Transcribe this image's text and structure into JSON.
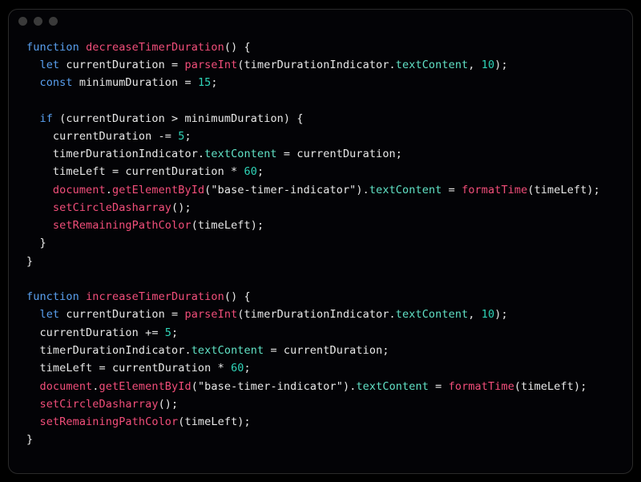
{
  "titlebar": {
    "dots": 3
  },
  "code": {
    "tokens": [
      {
        "c": "kw",
        "t": "function"
      },
      {
        "c": "pun",
        "t": " "
      },
      {
        "c": "fn",
        "t": "decreaseTimerDuration"
      },
      {
        "c": "pun",
        "t": "() {"
      },
      {
        "c": "nl",
        "t": "\n"
      },
      {
        "c": "pun",
        "t": "  "
      },
      {
        "c": "kw",
        "t": "let"
      },
      {
        "c": "pun",
        "t": " currentDuration = "
      },
      {
        "c": "fn",
        "t": "parseInt"
      },
      {
        "c": "pun",
        "t": "(timerDurationIndicator."
      },
      {
        "c": "prop",
        "t": "textContent"
      },
      {
        "c": "pun",
        "t": ", "
      },
      {
        "c": "num",
        "t": "10"
      },
      {
        "c": "pun",
        "t": ");"
      },
      {
        "c": "nl",
        "t": "\n"
      },
      {
        "c": "pun",
        "t": "  "
      },
      {
        "c": "kw",
        "t": "const"
      },
      {
        "c": "pun",
        "t": " minimumDuration = "
      },
      {
        "c": "num",
        "t": "15"
      },
      {
        "c": "pun",
        "t": ";"
      },
      {
        "c": "nl",
        "t": "\n"
      },
      {
        "c": "nl",
        "t": "\n"
      },
      {
        "c": "pun",
        "t": "  "
      },
      {
        "c": "kw",
        "t": "if"
      },
      {
        "c": "pun",
        "t": " (currentDuration > minimumDuration) {"
      },
      {
        "c": "nl",
        "t": "\n"
      },
      {
        "c": "pun",
        "t": "    currentDuration -= "
      },
      {
        "c": "num",
        "t": "5"
      },
      {
        "c": "pun",
        "t": ";"
      },
      {
        "c": "nl",
        "t": "\n"
      },
      {
        "c": "pun",
        "t": "    timerDurationIndicator."
      },
      {
        "c": "prop",
        "t": "textContent"
      },
      {
        "c": "pun",
        "t": " = currentDuration;"
      },
      {
        "c": "nl",
        "t": "\n"
      },
      {
        "c": "pun",
        "t": "    timeLeft = currentDuration * "
      },
      {
        "c": "num",
        "t": "60"
      },
      {
        "c": "pun",
        "t": ";"
      },
      {
        "c": "nl",
        "t": "\n"
      },
      {
        "c": "pun",
        "t": "    "
      },
      {
        "c": "doc",
        "t": "document"
      },
      {
        "c": "pun",
        "t": "."
      },
      {
        "c": "fn",
        "t": "getElementById"
      },
      {
        "c": "pun",
        "t": "("
      },
      {
        "c": "str",
        "t": "\"base-timer-indicator\""
      },
      {
        "c": "pun",
        "t": ")."
      },
      {
        "c": "prop",
        "t": "textContent"
      },
      {
        "c": "pun",
        "t": " = "
      },
      {
        "c": "fn",
        "t": "formatTime"
      },
      {
        "c": "pun",
        "t": "(timeLeft);"
      },
      {
        "c": "nl",
        "t": "\n"
      },
      {
        "c": "pun",
        "t": "    "
      },
      {
        "c": "fn",
        "t": "setCircleDasharray"
      },
      {
        "c": "pun",
        "t": "();"
      },
      {
        "c": "nl",
        "t": "\n"
      },
      {
        "c": "pun",
        "t": "    "
      },
      {
        "c": "fn",
        "t": "setRemainingPathColor"
      },
      {
        "c": "pun",
        "t": "(timeLeft);"
      },
      {
        "c": "nl",
        "t": "\n"
      },
      {
        "c": "pun",
        "t": "  }"
      },
      {
        "c": "nl",
        "t": "\n"
      },
      {
        "c": "pun",
        "t": "}"
      },
      {
        "c": "nl",
        "t": "\n"
      },
      {
        "c": "nl",
        "t": "\n"
      },
      {
        "c": "kw",
        "t": "function"
      },
      {
        "c": "pun",
        "t": " "
      },
      {
        "c": "fn",
        "t": "increaseTimerDuration"
      },
      {
        "c": "pun",
        "t": "() {"
      },
      {
        "c": "nl",
        "t": "\n"
      },
      {
        "c": "pun",
        "t": "  "
      },
      {
        "c": "kw",
        "t": "let"
      },
      {
        "c": "pun",
        "t": " currentDuration = "
      },
      {
        "c": "fn",
        "t": "parseInt"
      },
      {
        "c": "pun",
        "t": "(timerDurationIndicator."
      },
      {
        "c": "prop",
        "t": "textContent"
      },
      {
        "c": "pun",
        "t": ", "
      },
      {
        "c": "num",
        "t": "10"
      },
      {
        "c": "pun",
        "t": ");"
      },
      {
        "c": "nl",
        "t": "\n"
      },
      {
        "c": "pun",
        "t": "  currentDuration += "
      },
      {
        "c": "num",
        "t": "5"
      },
      {
        "c": "pun",
        "t": ";"
      },
      {
        "c": "nl",
        "t": "\n"
      },
      {
        "c": "pun",
        "t": "  timerDurationIndicator."
      },
      {
        "c": "prop",
        "t": "textContent"
      },
      {
        "c": "pun",
        "t": " = currentDuration;"
      },
      {
        "c": "nl",
        "t": "\n"
      },
      {
        "c": "pun",
        "t": "  timeLeft = currentDuration * "
      },
      {
        "c": "num",
        "t": "60"
      },
      {
        "c": "pun",
        "t": ";"
      },
      {
        "c": "nl",
        "t": "\n"
      },
      {
        "c": "pun",
        "t": "  "
      },
      {
        "c": "doc",
        "t": "document"
      },
      {
        "c": "pun",
        "t": "."
      },
      {
        "c": "fn",
        "t": "getElementById"
      },
      {
        "c": "pun",
        "t": "("
      },
      {
        "c": "str",
        "t": "\"base-timer-indicator\""
      },
      {
        "c": "pun",
        "t": ")."
      },
      {
        "c": "prop",
        "t": "textContent"
      },
      {
        "c": "pun",
        "t": " = "
      },
      {
        "c": "fn",
        "t": "formatTime"
      },
      {
        "c": "pun",
        "t": "(timeLeft);"
      },
      {
        "c": "nl",
        "t": "\n"
      },
      {
        "c": "pun",
        "t": "  "
      },
      {
        "c": "fn",
        "t": "setCircleDasharray"
      },
      {
        "c": "pun",
        "t": "();"
      },
      {
        "c": "nl",
        "t": "\n"
      },
      {
        "c": "pun",
        "t": "  "
      },
      {
        "c": "fn",
        "t": "setRemainingPathColor"
      },
      {
        "c": "pun",
        "t": "(timeLeft);"
      },
      {
        "c": "nl",
        "t": "\n"
      },
      {
        "c": "pun",
        "t": "}"
      }
    ]
  }
}
